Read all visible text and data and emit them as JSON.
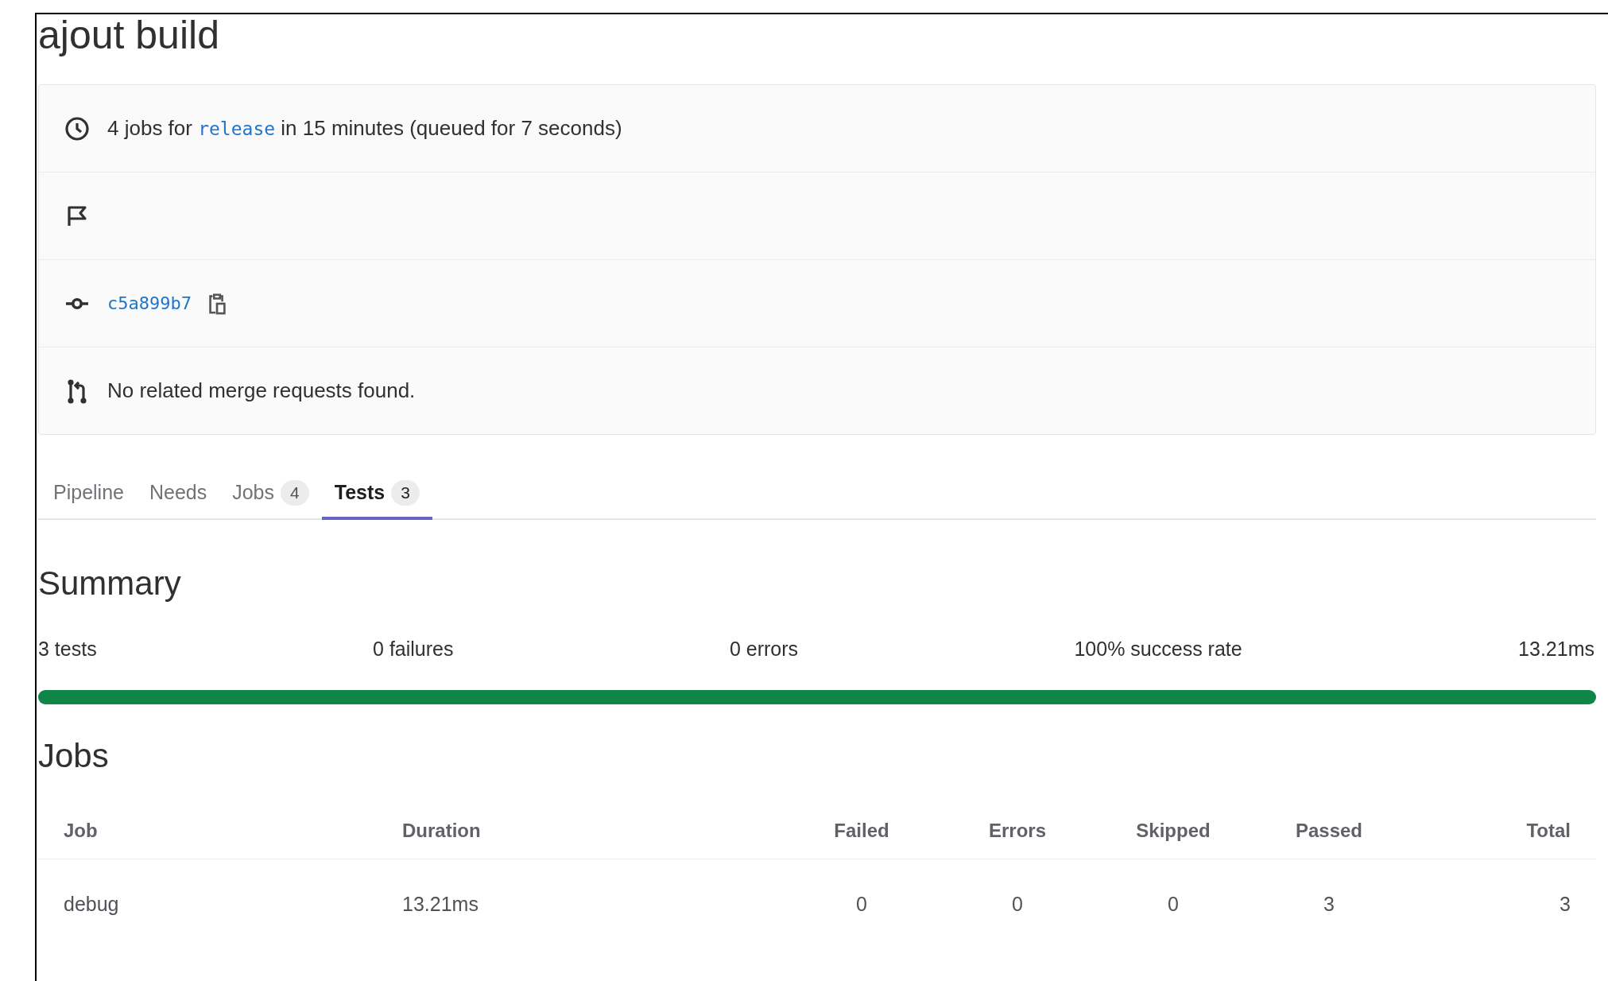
{
  "title": "ajout build",
  "info_rows": [
    {
      "kind": "pipeline",
      "before": "4 jobs for",
      "branch": "release",
      "after": "in 15 minutes (queued for 7 seconds)"
    },
    {
      "kind": "flag"
    },
    {
      "kind": "commit",
      "sha": "c5a899b7"
    },
    {
      "kind": "merge",
      "text": "No related merge requests found."
    }
  ],
  "tabs": [
    {
      "label": "Pipeline",
      "selected": false
    },
    {
      "label": "Needs",
      "selected": false
    },
    {
      "label": "Jobs",
      "count": "4",
      "selected": false
    },
    {
      "label": "Tests",
      "count": "3",
      "selected": true
    }
  ],
  "summary": {
    "heading": "Summary",
    "stats": [
      "3 tests",
      "0 failures",
      "0 errors",
      "100% success rate",
      "13.21ms"
    ],
    "level": 1
  },
  "jobs": {
    "heading": "Jobs",
    "columns": [
      "Job",
      "Duration",
      "Failed",
      "Errors",
      "Skipped",
      "Passed",
      "Total"
    ],
    "rows": [
      [
        "debug",
        "13.21ms",
        "0",
        "0",
        "0",
        "3",
        "3"
      ]
    ]
  }
}
